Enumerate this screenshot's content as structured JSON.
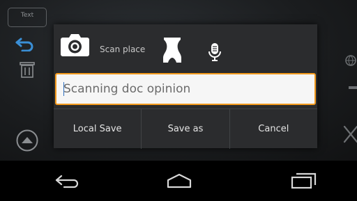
{
  "background_app": {
    "text_tab_label": "Text"
  },
  "dialog": {
    "toolbar": {
      "camera_icon": "camera-icon",
      "scan_label": "Scan place",
      "body_icon": "body-silhouette-icon",
      "mic_icon": "microphone-icon"
    },
    "input": {
      "value": "Scanning doc opinion",
      "placeholder": ""
    },
    "buttons": {
      "local_save": "Local Save",
      "save_as": "Save as",
      "cancel": "Cancel"
    }
  },
  "navbar": {
    "back_icon": "back-icon",
    "home_icon": "home-icon",
    "recents_icon": "recents-icon"
  },
  "colors": {
    "focus_border": "#f39a1d",
    "dialog_bg": "#2b2c2e",
    "navbar_bg": "#000000"
  }
}
